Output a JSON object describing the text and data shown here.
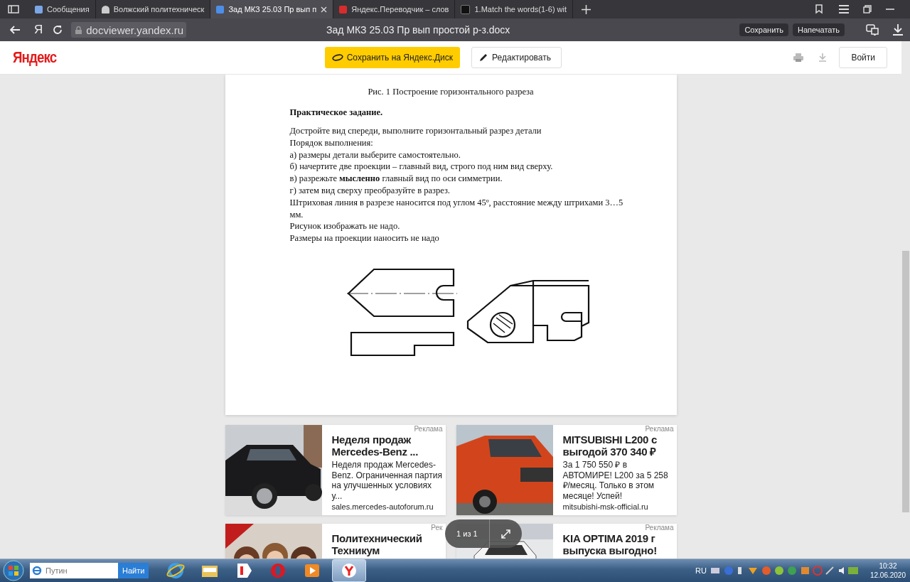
{
  "browser": {
    "tabs": [
      {
        "title": "Сообщения",
        "selected": false
      },
      {
        "title": "Волжский политехническ",
        "selected": false
      },
      {
        "title": "Зад МКЗ 25.03 Пр вып п",
        "selected": true
      },
      {
        "title": "Яндекс.Переводчик – слов",
        "selected": false
      },
      {
        "title": "1.Match the words(1-6) wit",
        "selected": false
      }
    ],
    "address": "docviewer.yandex.ru",
    "home_glyph": "Я",
    "page_title": "Зад МКЗ 25.03 Пр вып простой р-з.docx",
    "buttons": [
      "Сохранить",
      "Напечатать"
    ]
  },
  "viewer": {
    "logo": "Яндекс",
    "save_button": "Сохранить на Яндекс.Диск",
    "edit_button": "Редактировать",
    "login_button": "Войти"
  },
  "document": {
    "caption": "Рис. 1 Построение горизонтального разреза",
    "heading": "Практическое задание.",
    "lines": [
      "Достройте вид спереди, выполните горизонтальный  разрез детали",
      "Порядок выполнения:",
      "а) размеры детали выберите самостоятельно.",
      "б) начертите две проекции – главный вид, строго под ним вид сверху.",
      "в) разрежьте **мысленно** главный вид по оси симметрии.",
      "г) затем вид сверху преобразуйте в разрез.",
      "Штриховая линия в разрезе наносится  под углом 45º, расстояние между штрихами 3…5 мм.",
      "Рисунок изображать не надо.",
      "Размеры на проекции наносить не надо"
    ]
  },
  "ads": [
    {
      "kind": "sedan",
      "label": "Реклама",
      "title": "Неделя продаж Mercedes-Benz ...",
      "text": "Неделя продаж Mercedes-Benz. Ограниченная партия на улучшенных условиях у...",
      "domain": "sales.mercedes-autoforum.ru"
    },
    {
      "kind": "pickup",
      "label": "Реклама",
      "title": "MITSUBISHI L200 с выгодой 370 340 ₽",
      "text": "За 1 750 550 ₽ в АВТОМИРЕ! L200 за 5 258 ₽/месяц. Только в этом месяце! Успей!",
      "domain": "mitsubishi-msk-official.ru"
    },
    {
      "kind": "people",
      "label": "Рек",
      "title": "Политехнический Техникум"
    },
    {
      "kind": "showroom",
      "label": "Реклама",
      "title": "KIA OPTIMA 2019 г выпуска выгодно!"
    }
  ],
  "pager": {
    "text": "1 из 1"
  },
  "taskbar": {
    "search_placeholder": "Путин",
    "search_button": "Найти",
    "apps": [
      {
        "kind": "ie",
        "selected": false
      },
      {
        "kind": "folder",
        "selected": false
      },
      {
        "kind": "yandex",
        "selected": false
      },
      {
        "kind": "opera",
        "selected": false
      },
      {
        "kind": "media",
        "selected": false
      },
      {
        "kind": "ybrowser",
        "selected": true
      }
    ],
    "language": "RU",
    "time": "10:32",
    "date": "12.06.2020"
  }
}
